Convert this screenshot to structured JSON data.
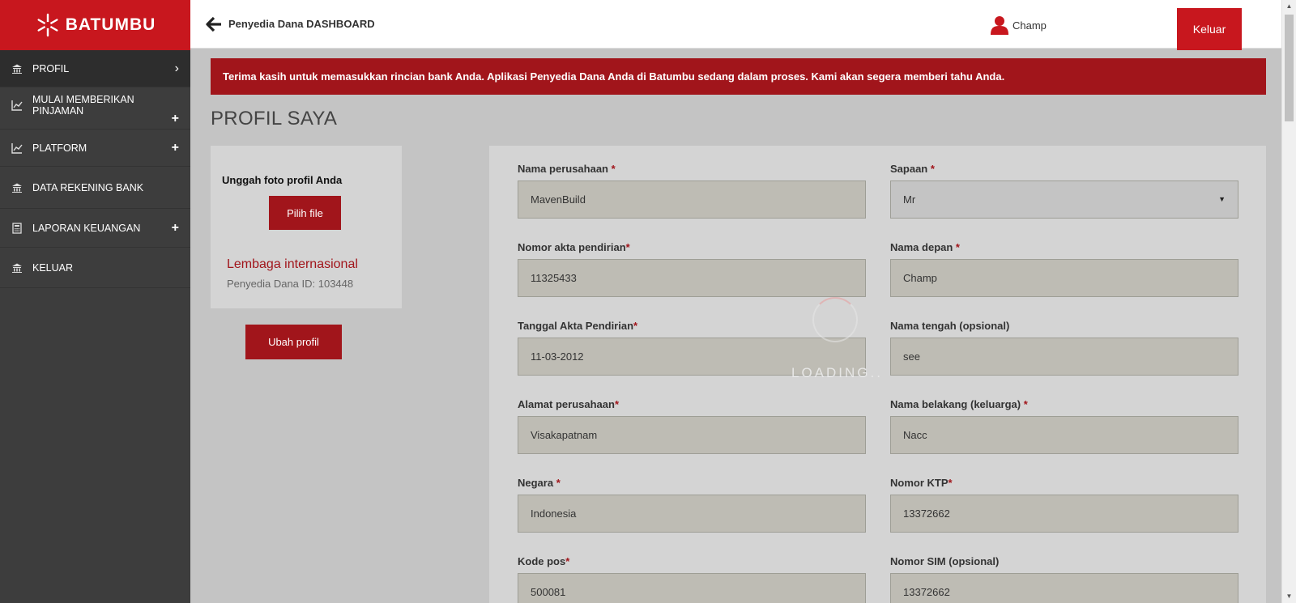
{
  "brand": {
    "name": "BATUMBU",
    "accent": "#c8171e",
    "accent_dark": "#a1151b"
  },
  "sidebar": {
    "items": [
      {
        "label": "PROFIL",
        "icon": "bank-icon",
        "indicator": "chevron"
      },
      {
        "label": "MULAI MEMBERIKAN PINJAMAN",
        "icon": "chart-icon",
        "indicator": "plus"
      },
      {
        "label": "PLATFORM",
        "icon": "chart-icon",
        "indicator": "plus"
      },
      {
        "label": "DATA REKENING BANK",
        "icon": "bank-icon",
        "indicator": "none"
      },
      {
        "label": "LAPORAN KEUANGAN",
        "icon": "calculator-icon",
        "indicator": "plus"
      },
      {
        "label": "KELUAR",
        "icon": "bank-icon",
        "indicator": "none"
      }
    ]
  },
  "header": {
    "breadcrumb": "Penyedia Dana DASHBOARD",
    "user_name": "Champ",
    "logout_label": "Keluar"
  },
  "alert": "Terima kasih untuk memasukkan rincian bank Anda. Aplikasi Penyedia Dana Anda di Batumbu sedang dalam proses. Kami akan segera memberi tahu Anda.",
  "page_title": "PROFIL SAYA",
  "profile_card": {
    "upload_label": "Unggah foto profil Anda",
    "pick_file_label": "Pilih file",
    "org_type": "Lembaga internasional",
    "funder_id": "Penyedia Dana ID: 103448",
    "edit_label": "Ubah profil"
  },
  "form": {
    "left": [
      {
        "label": "Nama perusahaan ",
        "req": "*",
        "value": "MavenBuild"
      },
      {
        "label": "Nomor akta pendirian",
        "req": "*",
        "value": "11325433"
      },
      {
        "label": "Tanggal Akta Pendirian",
        "req": "*",
        "value": "11-03-2012"
      },
      {
        "label": "Alamat perusahaan",
        "req": "*",
        "value": "Visakapatnam"
      },
      {
        "label": "Negara ",
        "req": "*",
        "value": "Indonesia"
      },
      {
        "label": "Kode pos",
        "req": "*",
        "value": "500081"
      }
    ],
    "right": [
      {
        "label": "Sapaan ",
        "req": "*",
        "value": "Mr"
      },
      {
        "label": "Nama depan ",
        "req": "*",
        "value": "Champ"
      },
      {
        "label": "Nama tengah (opsional)",
        "req": "",
        "value": "see"
      },
      {
        "label": "Nama belakang (keluarga) ",
        "req": "*",
        "value": "Nacc"
      },
      {
        "label": "Nomor KTP",
        "req": "*",
        "value": "13372662"
      },
      {
        "label": "Nomor SIM (opsional)",
        "req": "",
        "value": "13372662"
      }
    ]
  },
  "loading_text": "LOADING.."
}
